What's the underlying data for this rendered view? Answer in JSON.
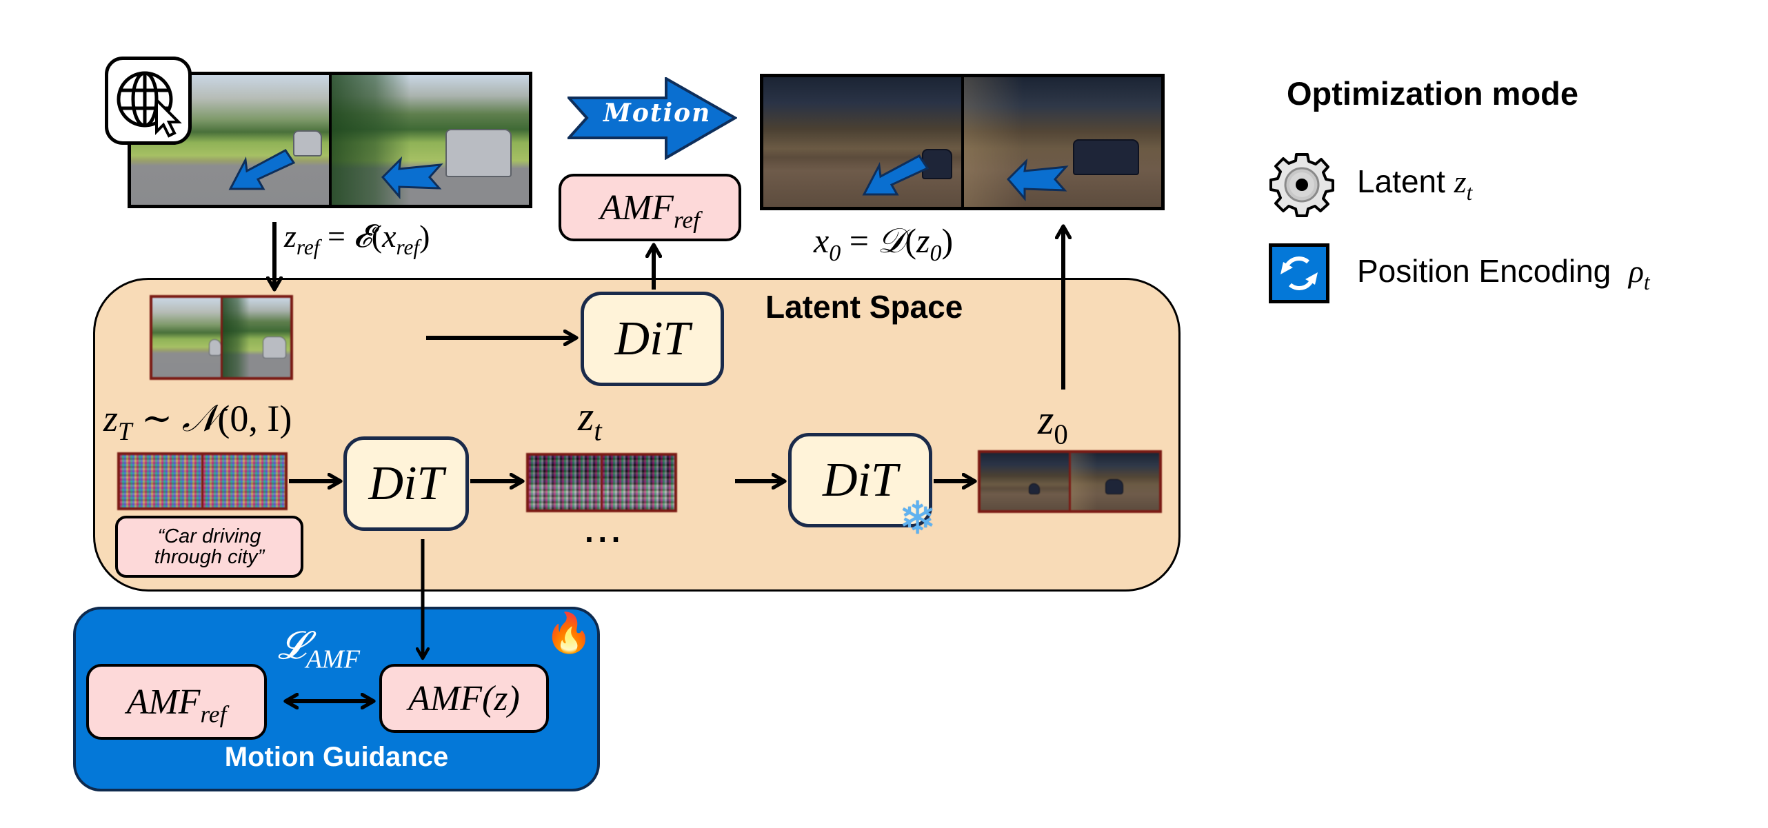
{
  "top": {
    "reference_caption": "z_ref = 𝓔(x_ref)",
    "reference_formula": {
      "lhs": "z",
      "lhs_sub": "ref",
      "eq": "=",
      "fn": "𝓔",
      "arg": "x",
      "arg_sub": "ref"
    },
    "motion_arrow_label": "Motion",
    "amf_ref_top": {
      "base": "AMF",
      "sub": "ref"
    },
    "output_formula": {
      "lhs": "x",
      "lhs_sub": "0",
      "eq": "=",
      "fn": "𝒟",
      "arg": "z",
      "arg_sub": "0"
    }
  },
  "latent_space": {
    "title": "Latent Space",
    "noise_label": {
      "lhs": "z",
      "lhs_sub": "T",
      "rel": "∼",
      "dist": "𝒩",
      "args": "(0, I)"
    },
    "zt_label": {
      "base": "z",
      "sub": "t"
    },
    "z0_label": {
      "base": "z",
      "sub": "0"
    },
    "dit_label": "DiT",
    "ellipsis": "···",
    "prompt_line1": "“Car driving",
    "prompt_line2": "through city”",
    "frozen_icon": "❄"
  },
  "motion_guidance": {
    "title": "Motion Guidance",
    "loss_label": {
      "base": "𝓛",
      "sub": "AMF"
    },
    "amf_ref": {
      "base": "AMF",
      "sub": "ref"
    },
    "amf_z": "AMF(z)",
    "trainable_icon": "🔥"
  },
  "legend": {
    "title": "Optimization mode",
    "items": [
      {
        "icon": "gear-icon",
        "label": "Latent",
        "math_base": "z",
        "math_sub": "t"
      },
      {
        "icon": "refresh-icon",
        "label": "Position Encoding",
        "math_base": "ρ",
        "math_sub": "t"
      }
    ]
  },
  "colors": {
    "latent_bg": "#f8dbb7",
    "guidance_bg": "#0478d8",
    "dit_bg": "#fff3d9",
    "amf_bg": "#fdd9d9",
    "arrow_blue": "#0a6fd0",
    "latent_frame": "#7a1a14"
  }
}
